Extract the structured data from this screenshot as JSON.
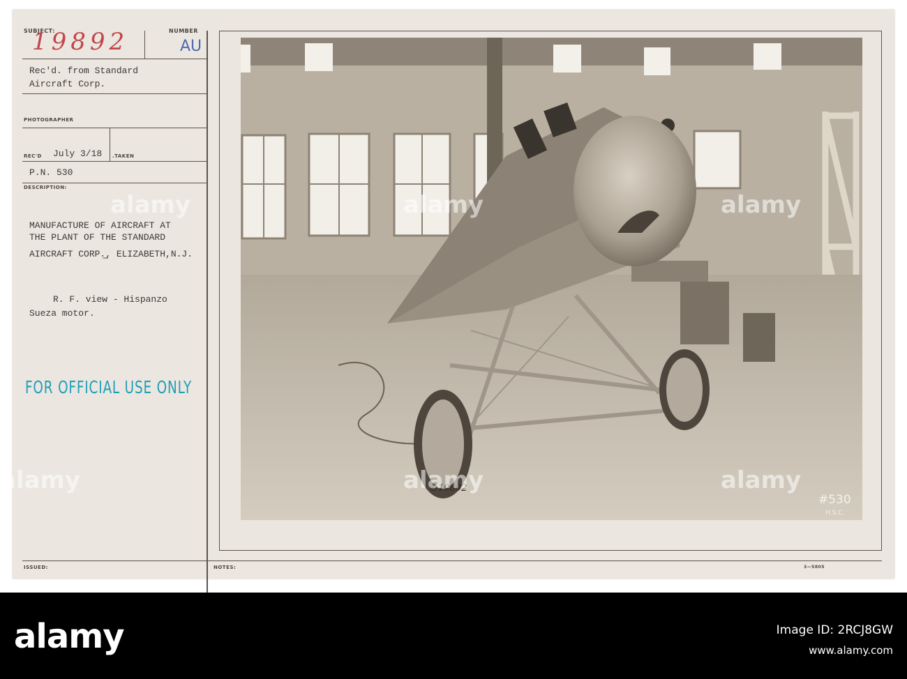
{
  "card": {
    "subject_label": "SUBJECT:",
    "subject_number": "19892",
    "number_label": "NUMBER",
    "number_value": "AU",
    "source_line1": "Rec'd. from Standard",
    "source_line2": "Aircraft Corp.",
    "photographer_label": "PHOTOGRAPHER",
    "recd_label": "REC'D",
    "recd_date": "July 3/18",
    "taken_label": ".TAKEN",
    "pn": "P.N. 530",
    "description_label": "DESCRIPTION:",
    "desc_line1": "MANUFACTURE OF AIRCRAFT AT",
    "desc_line2": "THE PLANT OF THE STANDARD",
    "desc_line3": "AIRCRAFT CORP.̲, ELIZABETH,N.J.",
    "desc_line4": "R. F. view - Hispanzo",
    "desc_line5": "Sueza motor.",
    "stamp": "FOR OFFICIAL USE ONLY",
    "issued_label": "ISSUED:",
    "notes_label": "NOTES:",
    "form_code": "3—5805"
  },
  "photo": {
    "negative_number": "©19892",
    "plate_number": "#530",
    "plate_initials": "H.S.C."
  },
  "watermarks": [
    "alamy",
    "alamy",
    "alamy",
    "alamy",
    "alamy",
    "alamy"
  ],
  "banner": {
    "logo": "alamy",
    "image_id_label": "Image ID: 2RCJ8GW",
    "url": "www.alamy.com"
  },
  "colors": {
    "card": "#ebe6df",
    "stamp": "#1f9fb8",
    "handwriting": "#c2464a",
    "au_ink": "#4f6ab0"
  }
}
